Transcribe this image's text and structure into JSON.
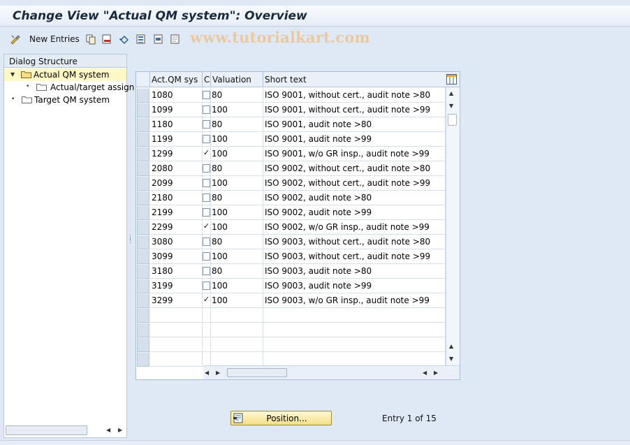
{
  "window": {
    "title": "Change View \"Actual QM system\": Overview"
  },
  "toolbar": {
    "new_entries_label": "New Entries",
    "watermark": "www.tutorialkart.com",
    "icons": [
      "edit-toggle-icon",
      "copy-icon",
      "delete-icon",
      "undo-icon",
      "select-all-icon",
      "select-block-icon",
      "deselect-all-icon"
    ]
  },
  "dialog_structure": {
    "header": "Dialog Structure",
    "items": [
      {
        "label": "Actual QM system",
        "level": 0,
        "expanded": true,
        "selected": true
      },
      {
        "label": "Actual/target assign",
        "level": 1,
        "expanded": false,
        "selected": false
      },
      {
        "label": "Target QM system",
        "level": 0,
        "expanded": false,
        "selected": false
      }
    ]
  },
  "table": {
    "columns": [
      "Act.QM sys",
      "C",
      "Valuation",
      "Short text"
    ],
    "rows": [
      {
        "sys": "1080",
        "c": false,
        "valuation": "80",
        "text": "ISO 9001, without cert., audit note >80"
      },
      {
        "sys": "1099",
        "c": false,
        "valuation": "100",
        "text": "ISO 9001, without cert., audit note >99"
      },
      {
        "sys": "1180",
        "c": false,
        "valuation": "80",
        "text": "ISO 9001, audit note >80"
      },
      {
        "sys": "1199",
        "c": false,
        "valuation": "100",
        "text": "ISO 9001, audit note >99"
      },
      {
        "sys": "1299",
        "c": true,
        "valuation": "100",
        "text": "ISO 9001, w/o GR insp., audit note >99"
      },
      {
        "sys": "2080",
        "c": false,
        "valuation": "80",
        "text": "ISO 9002, without cert., audit note >80"
      },
      {
        "sys": "2099",
        "c": false,
        "valuation": "100",
        "text": "ISO 9002, without cert., audit note >99"
      },
      {
        "sys": "2180",
        "c": false,
        "valuation": "80",
        "text": "ISO 9002, audit note >80"
      },
      {
        "sys": "2199",
        "c": false,
        "valuation": "100",
        "text": "ISO 9002, audit note >99"
      },
      {
        "sys": "2299",
        "c": true,
        "valuation": "100",
        "text": "ISO 9002, w/o GR insp., audit note >99"
      },
      {
        "sys": "3080",
        "c": false,
        "valuation": "80",
        "text": "ISO 9003, without cert., audit note >80"
      },
      {
        "sys": "3099",
        "c": false,
        "valuation": "100",
        "text": "ISO 9003, without cert., audit note >99"
      },
      {
        "sys": "3180",
        "c": false,
        "valuation": "80",
        "text": "ISO 9003, audit note >80"
      },
      {
        "sys": "3199",
        "c": false,
        "valuation": "100",
        "text": "ISO 9003, audit note >99"
      },
      {
        "sys": "3299",
        "c": true,
        "valuation": "100",
        "text": "ISO 9003, w/o GR insp., audit note >99"
      }
    ],
    "empty_rows": 4
  },
  "footer": {
    "position_button_label": "Position...",
    "entry_text": "Entry 1 of 15"
  },
  "colors": {
    "background": "#dfe9f5",
    "selected_tree_item": "#fff7c6",
    "position_button": "#f4df86"
  }
}
